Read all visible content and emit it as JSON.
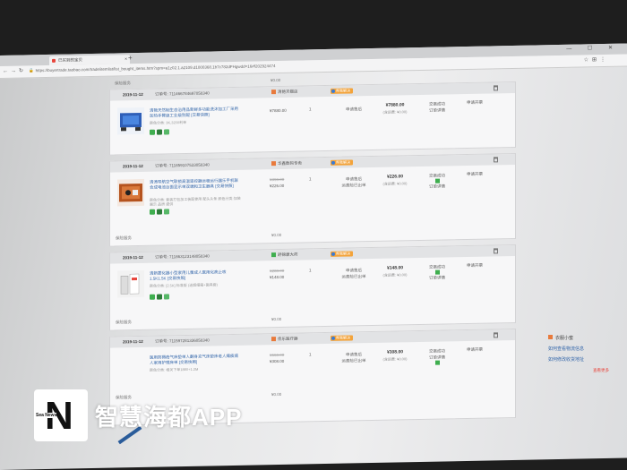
{
  "browser": {
    "tab_title": "已买到的宝贝",
    "new_tab": "+",
    "window_controls": "— ☐ ✕",
    "url": "https://buyertrade.taobao.com/trade/itemlist/list_bought_items.htm?spm=a1z02.1.a2109.d1000368.1b7c782dFHgwdd=16#f202924474"
  },
  "top_footer": {
    "label": "保险服务",
    "amount": "¥0.00"
  },
  "orders": [
    {
      "date": "2019-11-12",
      "order_no": "订单号: 711466784697050340",
      "shop": "清艳天猫店",
      "badge": "帮我解决",
      "title": "清艳天然制生态浴用品新鲜多功能洗沐加工厂采用加热手臂级工业级别配 [交易快照]",
      "spec": "颜色分类: 3K,3200利单",
      "orig_price": "",
      "price": "¥7880.00",
      "qty": "1",
      "service": [
        "申请售后"
      ],
      "total": "¥7880.00",
      "shipping": "(含运费: ¥0.00)",
      "status": [
        "交易成功",
        "订单详情"
      ],
      "action": "申请开票",
      "footer": null
    },
    {
      "date": "2019-11-12",
      "order_no": "订单号: 711859107533050340",
      "shop": "华鑫数码专卖",
      "badge": "帮我解决",
      "title": "清涛导航空气联锁高温遥控器远程运行器乐手机联合成电池台面显示单双端和卫生器具 [交易快照]",
      "spec": "颜色分类: 套装打包加工装配使用 配头头条 颜色分类·加装 展示 品质 提供",
      "orig_price": "¥390.00",
      "price": "¥226.00",
      "qty": "1",
      "service": [
        "申请售后",
        "运费险已出单"
      ],
      "total": "¥226.00",
      "shipping": "(含运费: ¥0.00)",
      "status": [
        "交易成功",
        "订单详情"
      ],
      "action": "申请开票",
      "footer": {
        "label": "保险服务",
        "amount": "¥0.00"
      }
    },
    {
      "date": "2019-11-12",
      "order_no": "订单号: 711863123148050340",
      "shop": "舒锦康大药",
      "badge": "帮我解决",
      "title": "清新雾化器小型家用儿童成人医用化痰止咳1.5K1.5K [交易快照]",
      "spec": "颜色分类: [2.5K] 标准版 (送超细箱+面具套)",
      "orig_price": "¥288.00",
      "price": "¥148.00",
      "qty": "1",
      "service": [
        "申请售后",
        "运费险已出单"
      ],
      "total": "¥148.00",
      "shipping": "(含运费: ¥0.00)",
      "status": [
        "交易成功",
        "订单详情"
      ],
      "action": "申请开票",
      "footer": {
        "label": "保险服务",
        "amount": "¥0.00"
      }
    },
    {
      "date": "2019-11-12",
      "order_no": "订单号: 711597281336050340",
      "shop": "佳乐医疗器",
      "badge": "帮我解决",
      "title": "医用防褥疮气床垫单人翻身充气床垫床老人瘫痪病人家用护理床单 [交易快照]",
      "spec": "颜色分类: 相关下单1880+1.2M",
      "orig_price": "¥660.00",
      "price": "¥308.00",
      "qty": "1",
      "service": [
        "申请售后",
        "运费险已出单"
      ],
      "total": "¥308.00",
      "shipping": "(含运费: ¥0.00)",
      "status": [
        "交易成功",
        "订单详情"
      ],
      "action": "申请开票",
      "footer": {
        "label": "保险服务",
        "amount": "¥0.00"
      }
    }
  ],
  "right_panel": {
    "header": "衣服小蜜",
    "links": [
      "如何查看物流信息",
      "如何修改收货地址"
    ],
    "more": "查看更多"
  },
  "watermark": {
    "logo_letter": "N",
    "logo_small": "Sea News",
    "text": "智慧海都APP"
  }
}
